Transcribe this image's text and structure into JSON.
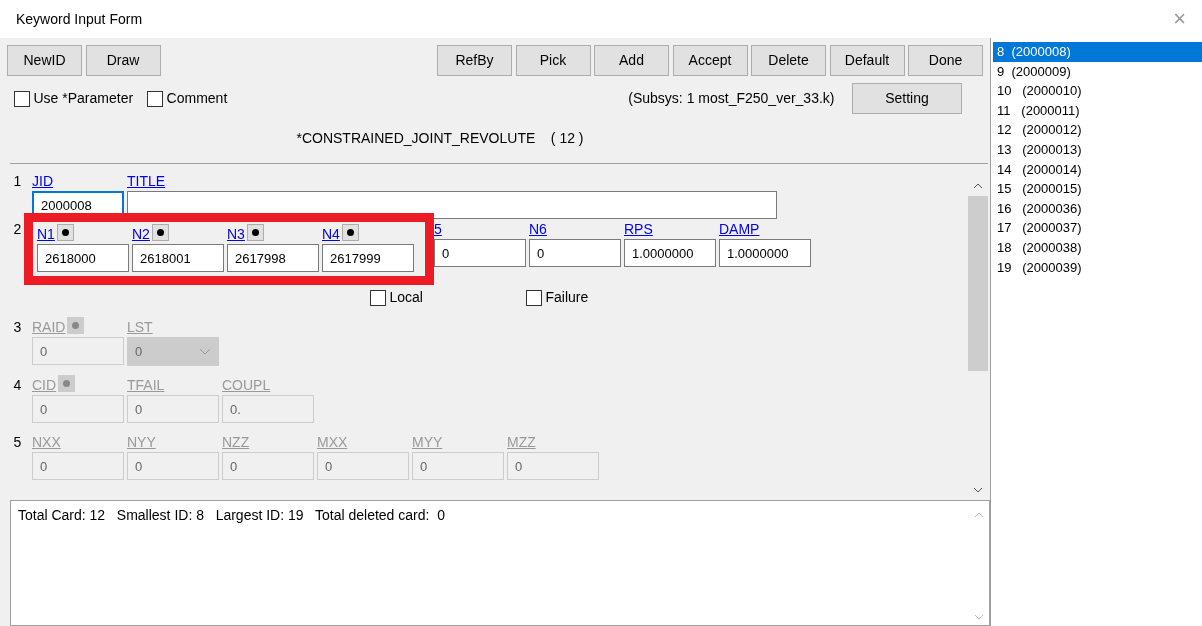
{
  "window": {
    "title": "Keyword Input Form",
    "close": "×"
  },
  "toolbar": {
    "left": [
      "NewID",
      "Draw"
    ],
    "right": [
      "RefBy",
      "Pick",
      "Add",
      "Accept",
      "Delete",
      "Default",
      "Done"
    ]
  },
  "options": [
    {
      "label": "Use *Parameter",
      "checked": false
    },
    {
      "label": "Comment",
      "checked": false
    }
  ],
  "subsys": "(Subsys: 1 most_F250_ver_33.k)",
  "setting_button": "Setting",
  "keyword": "*CONSTRAINED_JOINT_REVOLUTE    ( 12 )",
  "rows": [
    {
      "number": "1",
      "disabled": false,
      "fields": [
        {
          "label": "JID",
          "value": "2000008",
          "kind": "text",
          "pick": false,
          "focused": true
        },
        {
          "label": "TITLE",
          "kind": "wide",
          "pick": false,
          "focused": false
        }
      ]
    },
    {
      "number": "2",
      "disabled": false,
      "fields": [
        {
          "label": "N1",
          "value": "2618000",
          "kind": "text",
          "pick": true,
          "focused": false
        },
        {
          "label": "N2",
          "value": "2618001",
          "kind": "text",
          "pick": true,
          "focused": false
        },
        {
          "label": "N3",
          "value": "2617998",
          "kind": "text",
          "pick": true,
          "focused": false
        },
        {
          "label": "N4",
          "value": "2617999",
          "kind": "text",
          "pick": true,
          "focused": false
        },
        {
          "label": "5",
          "value": "0",
          "kind": "text",
          "pick": false,
          "focused": false
        },
        {
          "label": "N6",
          "value": "0",
          "kind": "text",
          "pick": false,
          "focused": false
        },
        {
          "label": "RPS",
          "value": "1.0000000",
          "kind": "text",
          "pick": false,
          "focused": false
        },
        {
          "label": "DAMP",
          "value": "1.0000000",
          "kind": "text",
          "pick": false,
          "focused": false
        }
      ],
      "checks": [
        {
          "label": "Local",
          "checked": false
        },
        {
          "label": "Failure",
          "checked": false
        }
      ]
    },
    {
      "number": "3",
      "disabled": true,
      "fields": [
        {
          "label": "RAID",
          "value": "0",
          "kind": "text",
          "pick": true,
          "focused": false
        },
        {
          "label": "LST",
          "value": "0",
          "kind": "select",
          "pick": false,
          "focused": false
        }
      ]
    },
    {
      "number": "4",
      "disabled": true,
      "fields": [
        {
          "label": "CID",
          "value": "0",
          "kind": "text",
          "pick": true,
          "focused": false
        },
        {
          "label": "TFAIL",
          "value": "0",
          "kind": "text",
          "pick": false,
          "focused": false
        },
        {
          "label": "COUPL",
          "value": "0.",
          "kind": "text",
          "pick": false,
          "focused": false
        }
      ]
    },
    {
      "number": "5",
      "disabled": true,
      "fields": [
        {
          "label": "NXX",
          "value": "0",
          "kind": "text",
          "pick": false,
          "focused": false
        },
        {
          "label": "NYY",
          "value": "0",
          "kind": "text",
          "pick": false,
          "focused": false
        },
        {
          "label": "NZZ",
          "value": "0",
          "kind": "text",
          "pick": false,
          "focused": false
        },
        {
          "label": "MXX",
          "value": "0",
          "kind": "text",
          "pick": false,
          "focused": false
        },
        {
          "label": "MYY",
          "value": "0",
          "kind": "text",
          "pick": false,
          "focused": false
        },
        {
          "label": "MZZ",
          "value": "0",
          "kind": "text",
          "pick": false,
          "focused": false
        }
      ]
    }
  ],
  "summary": "Total Card: 12   Smallest ID: 8   Largest ID: 19   Total deleted card:  0",
  "id_list": [
    {
      "label": "8  (2000008)",
      "selected": true
    },
    {
      "label": "9  (2000009)",
      "selected": false
    },
    {
      "label": "10   (2000010)",
      "selected": false
    },
    {
      "label": "11   (2000011)",
      "selected": false
    },
    {
      "label": "12   (2000012)",
      "selected": false
    },
    {
      "label": "13   (2000013)",
      "selected": false
    },
    {
      "label": "14   (2000014)",
      "selected": false
    },
    {
      "label": "15   (2000015)",
      "selected": false
    },
    {
      "label": "16   (2000036)",
      "selected": false
    },
    {
      "label": "17   (2000037)",
      "selected": false
    },
    {
      "label": "18   (2000038)",
      "selected": false
    },
    {
      "label": "19   (2000039)",
      "selected": false
    }
  ]
}
